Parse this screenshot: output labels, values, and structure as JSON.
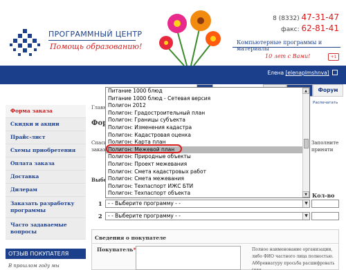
{
  "header": {
    "brand_title": "ПРОГРАММНЫЙ ЦЕНТР",
    "slogan": "Помощь образованию!",
    "phone_prefix": "8 (8332)",
    "phone": "47-31-47",
    "fax_prefix": "факс:",
    "fax": "62-81-41",
    "subtitle": "Компьютерные программы и материалы",
    "anniversary": "10 лет с Вами!",
    "gplus": "+1"
  },
  "user": {
    "name": "Елена",
    "login": "[elenaplmshnva]"
  },
  "tabs": {
    "forum": "Форум"
  },
  "sidebar": {
    "items": [
      {
        "label": "Форма заказа"
      },
      {
        "label": "Скидки и акции"
      },
      {
        "label": "Прайс-лист"
      },
      {
        "label": "Схемы приобретения"
      },
      {
        "label": "Оплата заказа"
      },
      {
        "label": "Доставка"
      },
      {
        "label": "Дилерам"
      },
      {
        "label": "Заказать разработку программы"
      },
      {
        "label": "Часто задаваемые вопросы"
      }
    ],
    "review_title": "ОТЗЫВ ПОКУПАТЕЛЯ",
    "review_text": "В прошлом году мы"
  },
  "main": {
    "breadcrumb": "Главн",
    "print_label": "Распечатать",
    "form_heading": "Форм",
    "text_left_1": "Спасиб",
    "text_left_2": "заказа",
    "text_right_1": "Заполните",
    "text_right_2": "приняти",
    "select_heading": "Выбер",
    "qty_heading": "Кол-во",
    "rows": [
      {
        "num": "1",
        "value": "- - Выберите программу - -"
      },
      {
        "num": "2",
        "value": "- - Выберите программу - -"
      }
    ],
    "info_title": "Сведения о покупателе",
    "buyer_label": "Покупатель",
    "buyer_star": "*",
    "buyer_hint": "Полное наименование организации, либо ФИО частного лица полностью. Аббревиатуру просьба расшифровать (для"
  },
  "dropdown": {
    "items": [
      {
        "label": "Питание 1000 блюд"
      },
      {
        "label": "Питание 1000 блюд - Сетевая версия"
      },
      {
        "label": "Полигон 2012"
      },
      {
        "label": "Полигон: Градостроительный план"
      },
      {
        "label": "Полигон: Границы субъекта"
      },
      {
        "label": "Полигон: Изменения кадастра"
      },
      {
        "label": "Полигон: Кадастровая оценка"
      },
      {
        "label": "Полигон: Карта план"
      },
      {
        "label": "Полигон: Межевой план"
      },
      {
        "label": "Полигон: Природные объекты"
      },
      {
        "label": "Полигон: Проект межевания"
      },
      {
        "label": "Полигон: Смета кадастровых работ"
      },
      {
        "label": "Полигон: Смета межевания"
      },
      {
        "label": "Полигон: Техпаспорт ИЖС БТИ"
      },
      {
        "label": "Полигон: Техпаспорт объекта"
      }
    ],
    "highlighted_index": 8
  },
  "colors": {
    "brand_blue": "#1c3f8c",
    "accent_red": "#d81b1b",
    "highlight_gray": "#b8b8b8"
  }
}
